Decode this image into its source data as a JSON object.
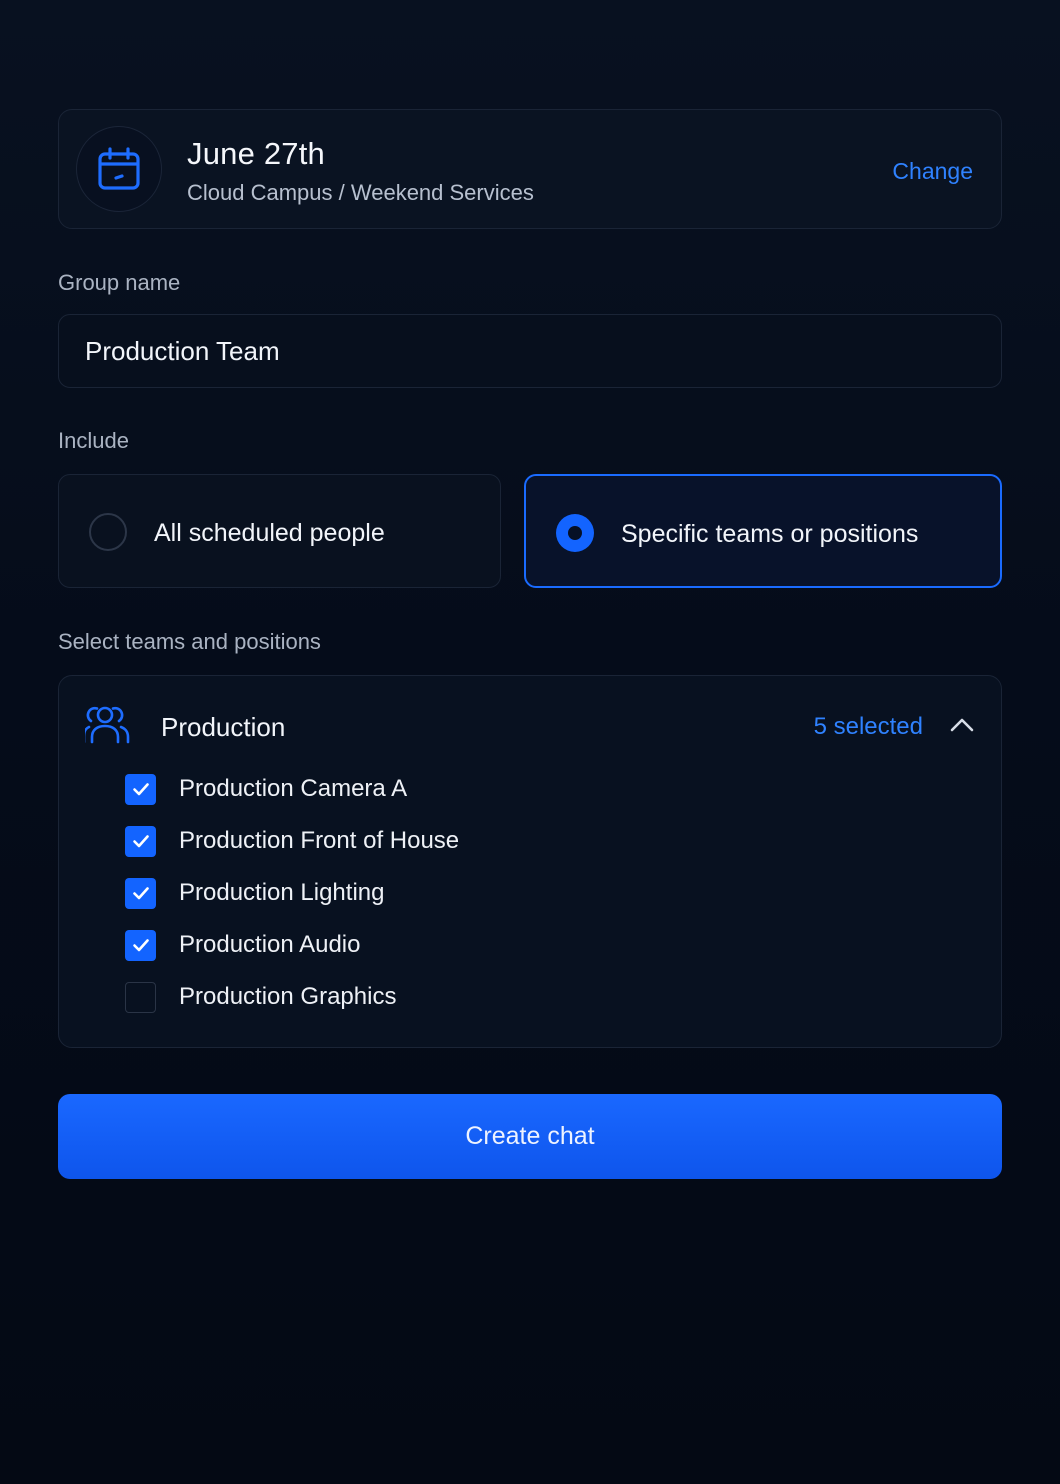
{
  "event": {
    "title": "June 27th",
    "subtitle": "Cloud Campus / Weekend Services",
    "icon": "calendar-icon",
    "change_label": "Change"
  },
  "group_name": {
    "label": "Group name",
    "value": "Production Team"
  },
  "include": {
    "label": "Include",
    "options": [
      {
        "label": "All scheduled people",
        "selected": false
      },
      {
        "label": "Specific teams or positions",
        "selected": true
      }
    ]
  },
  "teams": {
    "label": "Select teams and positions",
    "group": {
      "name": "Production",
      "icon": "people-icon",
      "selected_count": "5 selected",
      "expanded": true,
      "items": [
        {
          "label": "Production Camera A",
          "checked": true
        },
        {
          "label": "Production Front of House",
          "checked": true
        },
        {
          "label": "Production Lighting",
          "checked": true
        },
        {
          "label": "Production Audio",
          "checked": true
        },
        {
          "label": "Production Graphics",
          "checked": false
        }
      ]
    }
  },
  "create_button": {
    "label": "Create chat"
  },
  "colors": {
    "background": "#050b17",
    "accent": "#1364ff",
    "link": "#2f82ff",
    "card": "#0a1322",
    "border": "#1a2436"
  }
}
